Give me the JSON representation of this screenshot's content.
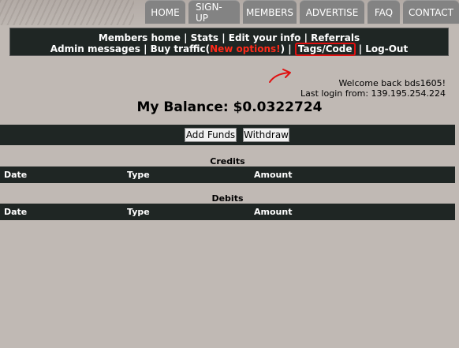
{
  "top_tabs": [
    "HOME",
    "SIGN-UP",
    "MEMBERS",
    "ADVERTISE",
    "FAQ",
    "CONTACT"
  ],
  "member_nav": {
    "members_home": "Members home",
    "stats": "Stats",
    "edit_info": "Edit your info",
    "referrals": "Referrals",
    "admin_messages": "Admin messages",
    "buy_traffic": "Buy traffic",
    "new_options": "New options!",
    "tags_code": "Tags/Code",
    "logout": "Log-Out",
    "separator": "|",
    "open_paren": "(",
    "close_paren": ")"
  },
  "annotation": {
    "color": "#e01010"
  },
  "user": {
    "welcome": "Welcome back bds1605!",
    "last_login": "Last login from: 139.195.254.224"
  },
  "balance": {
    "label": "My Balance: $0.0322724"
  },
  "buttons": {
    "add_funds": "Add Funds",
    "withdraw": "Withdraw"
  },
  "credits": {
    "title": "Credits",
    "columns": [
      "Date",
      "Type",
      "Amount"
    ]
  },
  "debits": {
    "title": "Debits",
    "columns": [
      "Date",
      "Type",
      "Amount"
    ]
  },
  "colors": {
    "page_bg": "#c0b9b4",
    "dark_bar": "#1f2624",
    "tab_bg": "#838383",
    "highlight_red": "#ff2a1a"
  }
}
